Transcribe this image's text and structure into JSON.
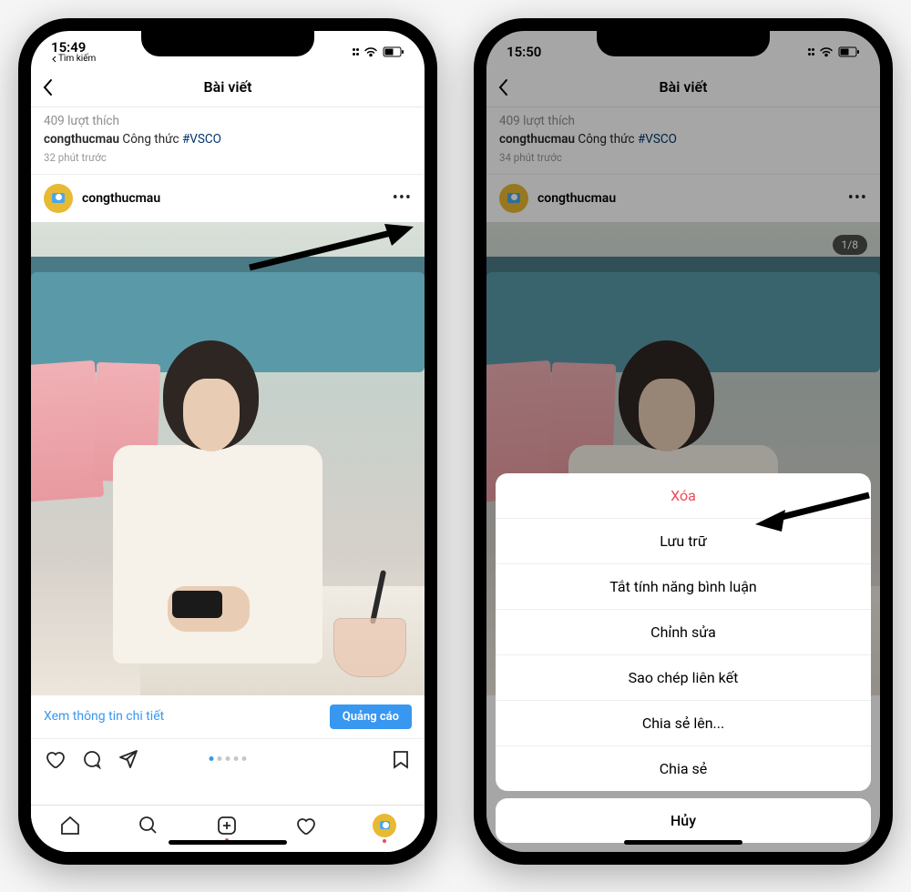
{
  "left": {
    "status": {
      "time": "15:49",
      "back_label": "Tìm kiếm"
    },
    "nav": {
      "title": "Bài viết"
    },
    "prev": {
      "likes": "409 lượt thích",
      "username": "congthucmau",
      "caption": "Công thức",
      "hashtag": "#VSCO",
      "time": "32 phút trước"
    },
    "post": {
      "username": "congthucmau"
    },
    "promo": {
      "link_label": "Xem thông tin chi tiết",
      "button_label": "Quảng cáo"
    }
  },
  "right": {
    "status": {
      "time": "15:50"
    },
    "nav": {
      "title": "Bài viết"
    },
    "prev": {
      "likes": "409 lượt thích",
      "username": "congthucmau",
      "caption": "Công thức",
      "hashtag": "#VSCO",
      "time": "34 phút trước"
    },
    "post": {
      "username": "congthucmau",
      "carousel_badge": "1/8"
    },
    "sheet": {
      "items": [
        {
          "label": "Xóa",
          "destructive": true
        },
        {
          "label": "Lưu trữ"
        },
        {
          "label": "Tắt tính năng bình luận"
        },
        {
          "label": "Chỉnh sửa"
        },
        {
          "label": "Sao chép liên kết"
        },
        {
          "label": "Chia sẻ lên..."
        },
        {
          "label": "Chia sẻ"
        }
      ],
      "cancel": "Hủy"
    }
  }
}
